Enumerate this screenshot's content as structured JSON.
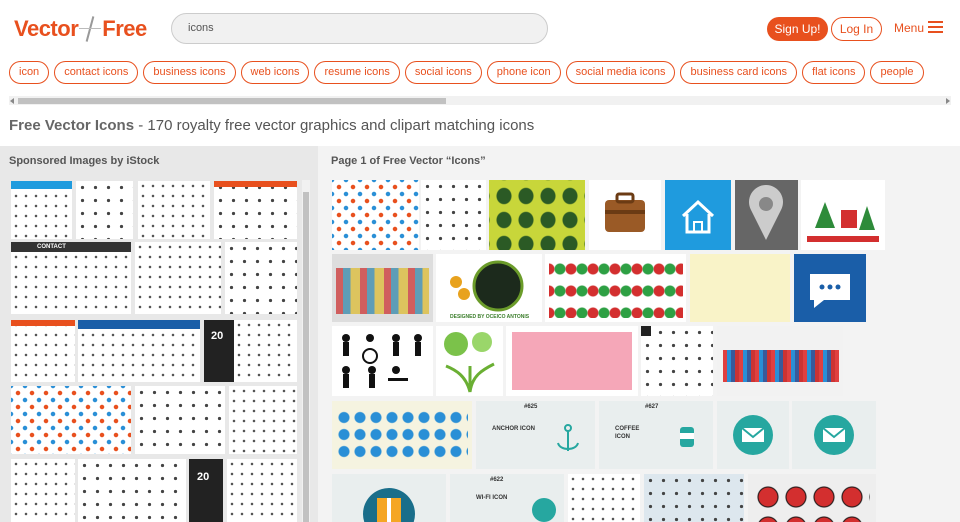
{
  "header": {
    "logo_left": "Vector",
    "logo_right": "Free",
    "search_value": "icons",
    "signup_label": "Sign Up!",
    "login_label": "Log In",
    "menu_label": "Menu"
  },
  "tags": [
    "icon",
    "contact icons",
    "business icons",
    "web icons",
    "resume icons",
    "social icons",
    "phone icon",
    "social media icons",
    "business card icons",
    "flat icons",
    "people"
  ],
  "page_title_bold": "Free Vector Icons",
  "page_title_rest": " - 170 royalty free vector graphics and clipart matching icons",
  "left_panel": {
    "heading": "Sponsored Images by iStock"
  },
  "right_panel": {
    "heading": "Page 1 of Free Vector “Icons”"
  },
  "thumb_texts": {
    "contact": "CONTACT",
    "num20a": "20",
    "num20b": "20",
    "anchor": "ANCHOR ICON",
    "coffee": "COFFEE ICON",
    "wifi": "WI-FI ICON",
    "n625": "#625",
    "n627": "#627",
    "n622": "#622",
    "designer": "DESIGNED BY OCEICO ANTONIS"
  },
  "colors": {
    "brand": "#e8501e",
    "blue_tile": "#1f9bde",
    "navy_tile": "#1a5ea8",
    "teal_tile": "#26a7a0"
  }
}
